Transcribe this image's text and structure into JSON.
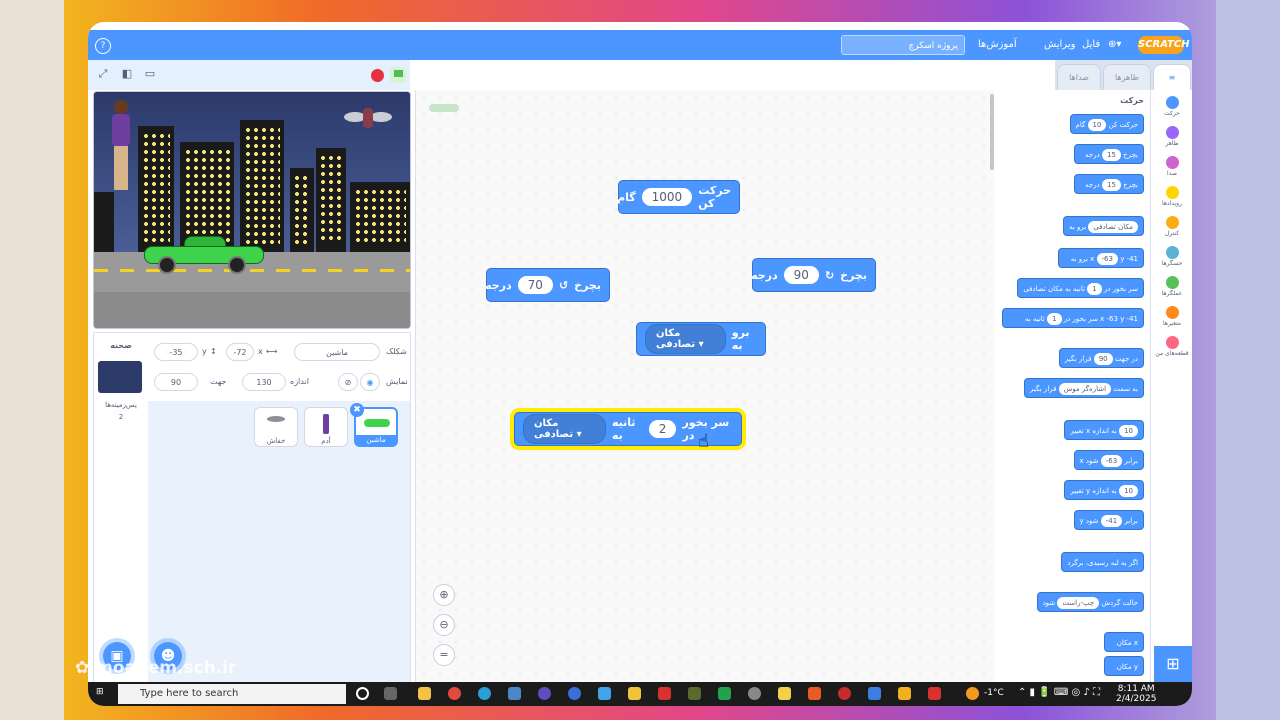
{
  "menubar": {
    "help": "?",
    "project_title": "پروژه اسکرچ",
    "tutorials": "آموزش‌ها",
    "edit": "ویرایش",
    "file": "فایل",
    "logo": "SCRATCH"
  },
  "tabs": {
    "sounds": "صداها",
    "costumes": "ظاهرها",
    "code": "کد"
  },
  "sprite_info": {
    "sprite_label": "شکلک",
    "sprite_name": "ماشین",
    "x_label": "x",
    "x_value": "-72",
    "y_label": "y",
    "y_value": "-35",
    "show_label": "نمایش",
    "size_label": "اندازه",
    "size_value": "130",
    "direction_label": "جهت",
    "direction_value": "90"
  },
  "stage_column": {
    "title": "صحنه",
    "backdrops_label": "پس‌زمینه‌ها",
    "backdrops_count": "2"
  },
  "sprites": [
    {
      "name": "ماشین",
      "selected": true
    },
    {
      "name": "آدم",
      "selected": false
    },
    {
      "name": "خفاش",
      "selected": false
    }
  ],
  "workspace_blocks": {
    "move": {
      "label": "حرکت کن",
      "value": "1000",
      "unit": "گام"
    },
    "turn_right": {
      "label": "بچرخ",
      "value": "90",
      "unit": "درجه"
    },
    "turn_left": {
      "label": "بچرخ",
      "value": "70",
      "unit": "درجه"
    },
    "goto": {
      "label": "برو به",
      "dropdown": "مکان تصادفی"
    },
    "glide": {
      "label": "سر بخور در",
      "value": "2",
      "middle": "ثانیه به",
      "dropdown": "مکان تصادفی"
    }
  },
  "palette": {
    "title": "حرکت",
    "blocks": [
      {
        "text": "حرکت کن",
        "ov": "10",
        "tail": "گام"
      },
      {
        "text": "بچرخ",
        "ov": "15",
        "tail": "درجه"
      },
      {
        "text": "بچرخ",
        "ov": "15",
        "tail": "درجه"
      },
      {
        "text": "برو به",
        "ov": "مکان تصادفی",
        "tail": ""
      },
      {
        "text": "برو به x",
        "ov": "-63",
        "tail": "y -41"
      },
      {
        "text": "سر بخور در",
        "ov": "1",
        "tail": "ثانیه به مکان تصادفی"
      },
      {
        "text": "سر بخور در",
        "ov": "1",
        "tail": "ثانیه به x -63 y -41"
      },
      {
        "text": "در جهت",
        "ov": "90",
        "tail": "قرار بگیر"
      },
      {
        "text": "به سمت",
        "ov": "اشاره‌گر موس",
        "tail": "قرار بگیر"
      },
      {
        "text": "تغییر x به اندازه",
        "ov": "10",
        "tail": ""
      },
      {
        "text": "x برابر",
        "ov": "-63",
        "tail": "شود"
      },
      {
        "text": "تغییر y به اندازه",
        "ov": "10",
        "tail": ""
      },
      {
        "text": "y برابر",
        "ov": "-41",
        "tail": "شود"
      },
      {
        "text": "اگر به لبه رسیدی، برگرد",
        "ov": "",
        "tail": ""
      },
      {
        "text": "حالت گردش",
        "ov": "چپ-راست",
        "tail": "شود"
      },
      {
        "text": "مکان x",
        "ov": "",
        "tail": ""
      },
      {
        "text": "مکان y",
        "ov": "",
        "tail": ""
      }
    ]
  },
  "categories": [
    {
      "name": "حرکت",
      "color": "#4c97ff"
    },
    {
      "name": "ظاهر",
      "color": "#9966ff"
    },
    {
      "name": "صدا",
      "color": "#cf63cf"
    },
    {
      "name": "رویدادها",
      "color": "#ffd500"
    },
    {
      "name": "کنترل",
      "color": "#ffab19"
    },
    {
      "name": "حسگرها",
      "color": "#5cb1d6"
    },
    {
      "name": "عملگرها",
      "color": "#59c059"
    },
    {
      "name": "متغیرها",
      "color": "#ff8c1a"
    },
    {
      "name": "قطعه‌های من",
      "color": "#ff6680"
    }
  ],
  "taskbar": {
    "search_placeholder": "Type here to search",
    "temperature": "-1°C",
    "time": "8:11 AM",
    "date": "2/4/2025"
  },
  "watermark": "moallem.sch.ir"
}
